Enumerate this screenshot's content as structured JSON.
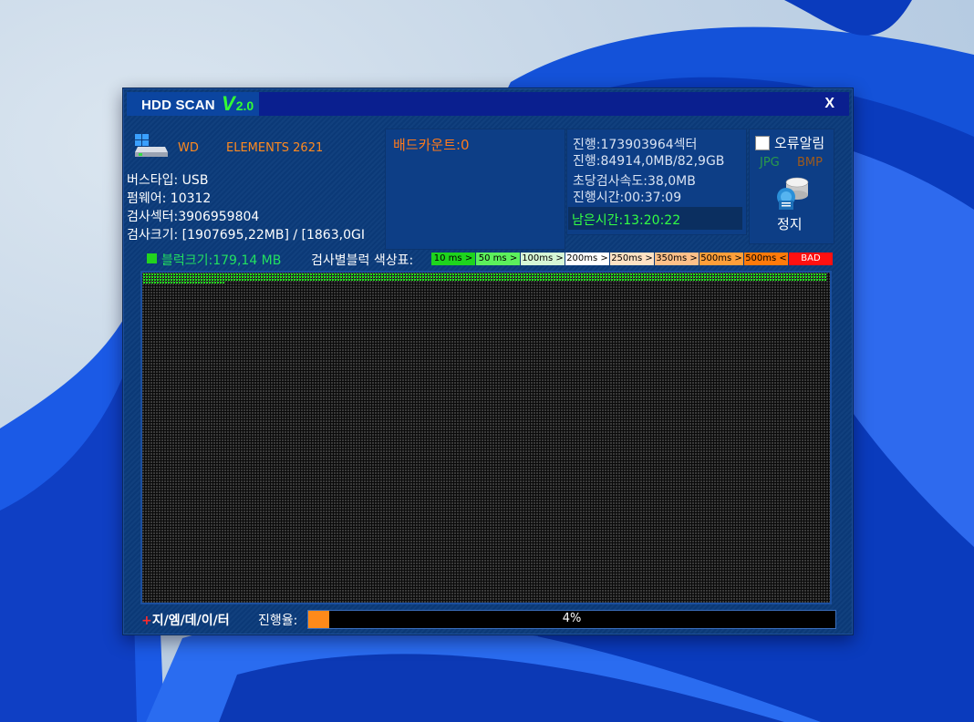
{
  "app": {
    "title": "HDD SCAN",
    "version_prefix": "V",
    "version_number": "2.0",
    "close_label": "X"
  },
  "drive": {
    "icon": "hard-drive-icon",
    "brand": "WD",
    "model": "ELEMENTS 2621",
    "bus_type": "버스타입: USB",
    "firmware": "펌웨어: 10312",
    "scan_sectors": "검사섹터:3906959804",
    "scan_size": "검사크기: [1907695,22MB] / [1863,0GI"
  },
  "bad": {
    "count_label": "배드카운트:0"
  },
  "stats": {
    "progress_sectors": "진행:173903964섹터",
    "progress_bytes": "진행:84914,0MB/82,9GB",
    "speed": "초당검사속도:38,0MB",
    "elapsed": "진행시간:00:37:09",
    "remaining": "남은시간:13:20:22"
  },
  "side": {
    "error_alert_label": "오류알림",
    "error_alert_checked": false,
    "format_jpg": "JPG",
    "format_bmp": "BMP",
    "stop_icon": "database-scan-icon",
    "stop_label": "정지"
  },
  "legend": {
    "block_size": "블럭크기:179,14 MB",
    "title": "검사별블럭 색상표:",
    "items": [
      {
        "label": "10 ms >",
        "color": "#1ed41e",
        "width": 48
      },
      {
        "label": "50 ms >",
        "color": "#5cf05c",
        "width": 48
      },
      {
        "label": "100ms >",
        "color": "#d6f7d6",
        "width": 48
      },
      {
        "label": "200ms >",
        "color": "#ffffff",
        "width": 48
      },
      {
        "label": "250ms >",
        "color": "#ffe2c4",
        "width": 48
      },
      {
        "label": "350ms >",
        "color": "#ffc089",
        "width": 48
      },
      {
        "label": "500ms >",
        "color": "#ff9f3a",
        "width": 48
      },
      {
        "label": "500ms <",
        "color": "#ff7a0a",
        "width": 48
      },
      {
        "label": "BAD",
        "color": "#ff1010",
        "width": 48
      }
    ]
  },
  "scan_map": {
    "good_color": "#22e01e",
    "empty_color": "#3a3a3a",
    "completed_full_rows": 3,
    "completed_partial_row_blocks": 30
  },
  "footer": {
    "brand_plus": "+",
    "brand_text": "지/엠/데/이/터",
    "progress_label": "진행율:",
    "progress_percent": 4,
    "progress_text": "4%"
  }
}
